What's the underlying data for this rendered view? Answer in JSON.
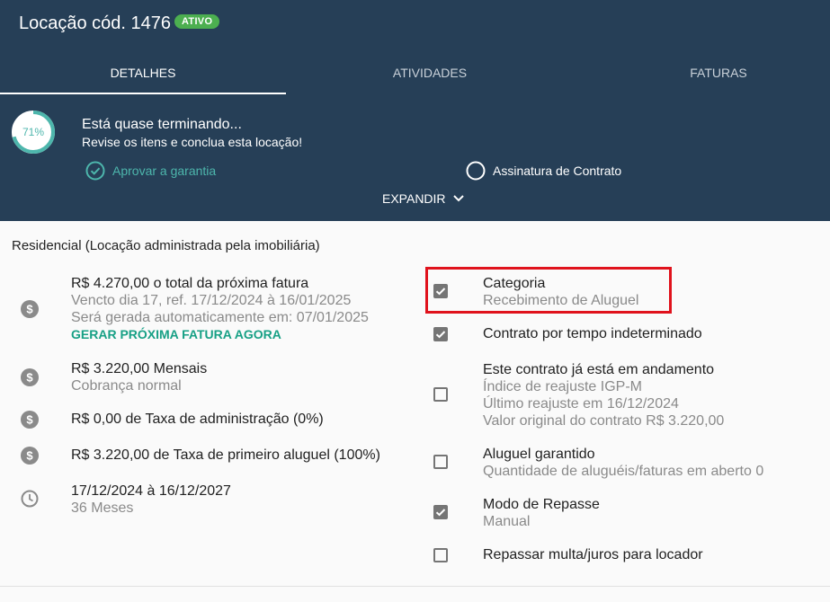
{
  "header": {
    "title": "Locação cód. 1476",
    "status_badge": "ATIVO",
    "tabs": [
      {
        "label": "DETALHES",
        "active": true
      },
      {
        "label": "ATIVIDADES",
        "active": false
      },
      {
        "label": "FATURAS",
        "active": false
      }
    ],
    "progress": {
      "label": "71%",
      "value": 0.71
    },
    "almost": {
      "title": "Está quase terminando...",
      "subtitle": "Revise os itens e conclua esta locação!"
    },
    "tasks": [
      {
        "label": "Aprovar a garantia",
        "done": true,
        "icon": "check-circle-icon"
      },
      {
        "label": "Assinatura de Contrato",
        "done": false,
        "icon": "circle-icon"
      }
    ],
    "expand_label": "EXPANDIR",
    "colors": {
      "header_bg": "#263f57",
      "accent": "#4db6ac",
      "badge": "#4caf50"
    }
  },
  "main": {
    "section_title": "Residencial (Locação administrada pela imobiliária)",
    "left_items": [
      {
        "icon": "dollar-icon",
        "main": "R$ 4.270,00 o total da próxima fatura",
        "sub": [
          "Vencto dia 17, ref. 17/12/2024 à 16/01/2025",
          "Será gerada automaticamente em: 07/01/2025"
        ],
        "link": "GERAR PRÓXIMA FATURA AGORA"
      },
      {
        "icon": "dollar-icon",
        "main": "R$ 3.220,00 Mensais",
        "sub": [
          "Cobrança normal"
        ]
      },
      {
        "icon": "dollar-icon",
        "main": "R$ 0,00 de Taxa de administração (0%)",
        "sub": []
      },
      {
        "icon": "dollar-icon",
        "main": "R$ 3.220,00 de Taxa de primeiro aluguel (100%)",
        "sub": []
      },
      {
        "icon": "clock-icon",
        "main": "17/12/2024 à 16/12/2027",
        "sub": [
          "36 Meses"
        ]
      }
    ],
    "right_items": [
      {
        "checked": true,
        "main": "Categoria",
        "sub": [
          "Recebimento de Aluguel"
        ]
      },
      {
        "checked": true,
        "main": "Contrato por tempo indeterminado",
        "sub": []
      },
      {
        "checked": false,
        "main": "Este contrato já está em andamento",
        "sub": [
          "Índice de reajuste IGP-M",
          "Último reajuste em 16/12/2024",
          "Valor original do contrato R$ 3.220,00"
        ]
      },
      {
        "checked": false,
        "main": "Aluguel garantido",
        "sub": [
          "Quantidade de aluguéis/faturas em aberto 0"
        ]
      },
      {
        "checked": true,
        "main": "Modo de Repasse",
        "sub": [
          "Manual"
        ]
      },
      {
        "checked": false,
        "main": "Repassar multa/juros para locador",
        "sub": []
      }
    ],
    "highlight_color": "#e0121c"
  }
}
